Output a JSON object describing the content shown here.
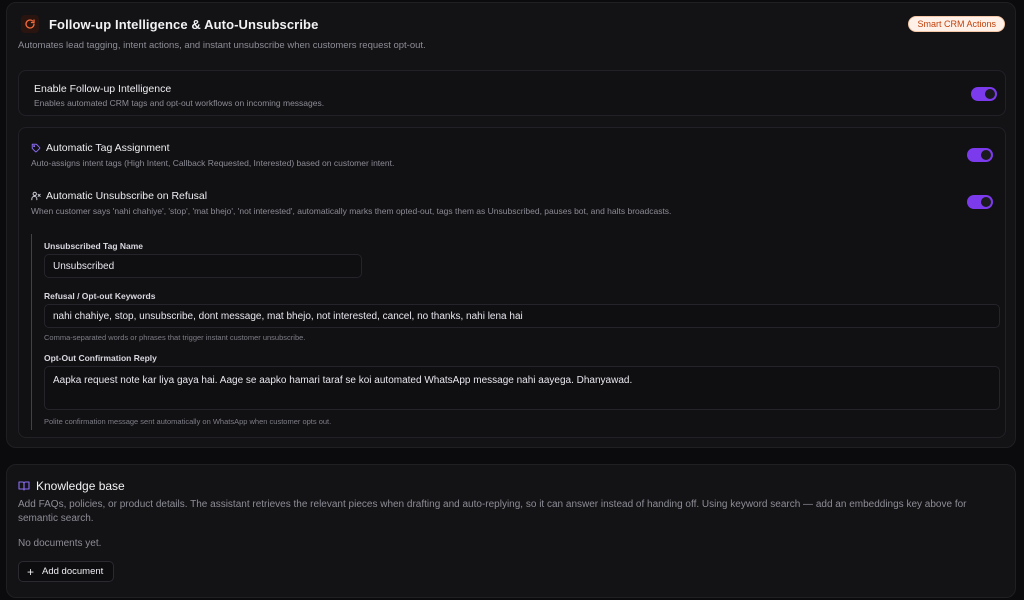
{
  "followup": {
    "title": "Follow-up Intelligence & Auto-Unsubscribe",
    "description": "Automates lead tagging, intent actions, and instant unsubscribe when customers request opt-out.",
    "badge": "Smart CRM Actions",
    "icon": "refresh-icon",
    "enable": {
      "title": "Enable Follow-up Intelligence",
      "description": "Enables automated CRM tags and opt-out workflows on incoming messages.",
      "on": true
    },
    "tag_assignment": {
      "title": "Automatic Tag Assignment",
      "description": "Auto-assigns intent tags (High Intent, Callback Requested, Interested) based on customer intent.",
      "icon": "tag-icon",
      "on": true
    },
    "auto_unsubscribe": {
      "title": "Automatic Unsubscribe on Refusal",
      "description": "When customer says 'nahi chahiye', 'stop', 'mat bhejo', 'not interested', automatically marks them opted-out, tags them as Unsubscribed, pauses bot, and halts broadcasts.",
      "icon": "user-x-icon",
      "on": true
    },
    "fields": {
      "tag_name_label": "Unsubscribed Tag Name",
      "tag_name_value": "Unsubscribed",
      "keywords_label": "Refusal / Opt-out Keywords",
      "keywords_value": "nahi chahiye, stop, unsubscribe, dont message, mat bhejo, not interested, cancel, no thanks, nahi lena hai",
      "keywords_hint": "Comma-separated words or phrases that trigger instant customer unsubscribe.",
      "reply_label": "Opt-Out Confirmation Reply",
      "reply_value": "Aapka request note kar liya gaya hai. Aage se aapko hamari taraf se koi automated WhatsApp message nahi aayega. Dhanyawad.",
      "reply_hint": "Polite confirmation message sent automatically on WhatsApp when customer opts out."
    }
  },
  "knowledge_base": {
    "title": "Knowledge base",
    "icon": "book-icon",
    "description": "Add FAQs, policies, or product details. The assistant retrieves the relevant pieces when drafting and auto-replying, so it can answer instead of handing off. Using keyword search — add an embeddings key above for semantic search.",
    "empty_text": "No documents yet.",
    "add_label": "Add document"
  },
  "colors": {
    "accent": "#7c3aed",
    "badge_text": "#c2410c",
    "icon_orange": "#f26b3a"
  }
}
